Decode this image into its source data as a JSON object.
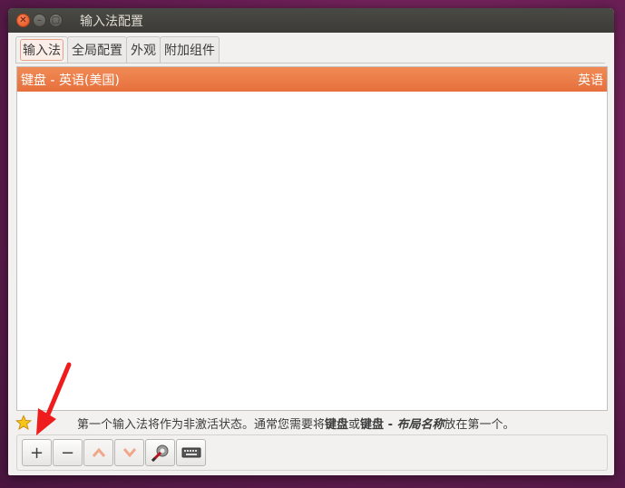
{
  "window": {
    "title": "输入法配置"
  },
  "tabs": [
    {
      "label": "输入法",
      "active": true
    },
    {
      "label": "全局配置",
      "active": false
    },
    {
      "label": "外观",
      "active": false
    },
    {
      "label": "附加组件",
      "active": false
    }
  ],
  "input_methods": [
    {
      "name": "键盘 - 英语(美国)",
      "language": "英语",
      "selected": true
    }
  ],
  "hint": {
    "text1": "第一个输入法将作为非激活状态。通常您需要将",
    "bold1": "键盘",
    "text2": "或",
    "bold2": "键盘 - ",
    "italic": "布局名称",
    "text3": "放在第一个。"
  },
  "toolbar": {
    "add_label": "+",
    "remove_label": "−",
    "up_icon": "chevron-up-icon",
    "down_icon": "chevron-down-icon",
    "configure_icon": "configure-icon",
    "keyboard_icon": "keyboard-icon"
  },
  "colors": {
    "accent": "#e95420",
    "selection": "#f07746"
  }
}
